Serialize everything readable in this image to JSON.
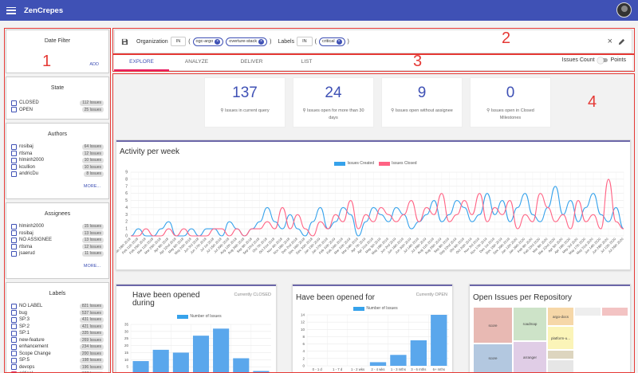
{
  "app": {
    "title": "ZenCrepes"
  },
  "annotations": [
    "1",
    "2",
    "3",
    "4"
  ],
  "sidebar": {
    "date_filter": {
      "title": "Date Filter",
      "add_label": "ADD"
    },
    "state": {
      "title": "State",
      "items": [
        {
          "label": "CLOSED",
          "count": "112 Issues"
        },
        {
          "label": "OPEN",
          "count": "25 Issues"
        }
      ]
    },
    "authors": {
      "title": "Authors",
      "more_label": "MORE...",
      "items": [
        {
          "label": "rosibaj",
          "count": "64 Issues"
        },
        {
          "label": "rtlsma",
          "count": "12 Issues"
        },
        {
          "label": "hlminh2000",
          "count": "10 Issues"
        },
        {
          "label": "kcullion",
          "count": "10 Issues"
        },
        {
          "label": "andricDu",
          "count": "8 Issues"
        }
      ]
    },
    "assignees": {
      "title": "Assignees",
      "more_label": "MORE...",
      "items": [
        {
          "label": "hlminh2000",
          "count": "15 Issues"
        },
        {
          "label": "rosibaj",
          "count": "13 Issues"
        },
        {
          "label": "NO ASSIGNEE",
          "count": "13 Issues"
        },
        {
          "label": "rtlsma",
          "count": "12 Issues"
        },
        {
          "label": "jsaerud",
          "count": "11 Issues"
        }
      ]
    },
    "labels": {
      "title": "Labels",
      "items": [
        {
          "label": "NO LABEL",
          "count": "821 Issues",
          "checked": false
        },
        {
          "label": "bug",
          "count": "537 Issues",
          "checked": false
        },
        {
          "label": "SP:3",
          "count": "431 Issues",
          "checked": false
        },
        {
          "label": "SP:2",
          "count": "421 Issues",
          "checked": false
        },
        {
          "label": "SP:1",
          "count": "335 Issues",
          "checked": false
        },
        {
          "label": "new-feature",
          "count": "269 Issues",
          "checked": false
        },
        {
          "label": "enhancement",
          "count": "234 Issues",
          "checked": false
        },
        {
          "label": "Scope Change",
          "count": "200 Issues",
          "checked": false
        },
        {
          "label": "SP:5",
          "count": "198 Issues",
          "checked": false
        },
        {
          "label": "devops",
          "count": "196 Issues",
          "checked": false
        },
        {
          "label": "critical",
          "count": "137 Issues",
          "checked": true
        }
      ]
    }
  },
  "query": {
    "organization_label": "Organization",
    "org_op": "IN",
    "org_chips": [
      "ogc-argo",
      "overture-stack"
    ],
    "labels_label": "Labels",
    "labels_op": "IN",
    "label_chips": [
      "critical"
    ]
  },
  "tabs": [
    "EXPLORE",
    "ANALYZE",
    "DELIVER",
    "LIST"
  ],
  "toggle": {
    "left": "Issues Count",
    "right": "Points"
  },
  "kpis": [
    {
      "value": "137",
      "desc": "Issues in current query"
    },
    {
      "value": "24",
      "desc": "Issues open for more than 30 days"
    },
    {
      "value": "9",
      "desc": "Issues open without assignee"
    },
    {
      "value": "0",
      "desc": "Issues open in Closed Milestones"
    }
  ],
  "activity": {
    "title": "Activity per week",
    "legend": [
      "Issues Created",
      "Issues Closed"
    ],
    "colors": [
      "#36a2eb",
      "#ff6384"
    ]
  },
  "opened_during": {
    "title_line1": "Have been opened",
    "title_line2": "during",
    "subtitle": "Currently CLOSED",
    "legend": "Number of Issues"
  },
  "opened_for": {
    "title": "Have been opened for",
    "subtitle": "Currently OPEN",
    "legend": "Number of Issues"
  },
  "repos": {
    "title": "Open Issues per Repository",
    "cells": [
      "score",
      "roadmap",
      "argo-docs",
      "platform-u...",
      "arranger",
      "score",
      "",
      ""
    ]
  },
  "chart_data": [
    {
      "type": "line",
      "title": "Activity per week",
      "x": [
        "Jan 28th 2018",
        "Feb 11th 2018",
        "Feb 25th 2018",
        "Mar 11th 2018",
        "Mar 25th 2018",
        "Apr 8th 2018",
        "Apr 22nd 2018",
        "May 6th 2018",
        "May 20th 2018",
        "Jun 3rd 2018",
        "Jun 17th 2018",
        "Jul 1st 2018",
        "Jul 15th 2018",
        "Jul 29th 2018",
        "Aug 12th 2018",
        "Aug 26th 2018",
        "Sep 9th 2018",
        "Sep 23rd 2018",
        "Oct 7th 2018",
        "Oct 21st 2018",
        "Nov 4th 2018",
        "Nov 18th 2018",
        "Dec 2nd 2018",
        "Dec 16th 2018",
        "Dec 30th 2018",
        "Jan 13th 2019",
        "Jan 27th 2019",
        "Feb 10th 2019",
        "Feb 24th 2019",
        "Mar 10th 2019",
        "Mar 24th 2019",
        "Apr 7th 2019",
        "Apr 21st 2019",
        "May 5th 2019",
        "May 19th 2019",
        "Jun 2nd 2019",
        "Jun 16th 2019",
        "Jun 30th 2019",
        "Jul 14th 2019",
        "Jul 28th 2019",
        "Aug 11th 2019",
        "Aug 25th 2019",
        "Sep 8th 2019",
        "Sep 22nd 2019",
        "Oct 6th 2019",
        "Oct 20th 2019",
        "Nov 3rd 2019",
        "Nov 17th 2019",
        "Dec 1st 2019",
        "Dec 15th 2019",
        "Dec 29th 2019",
        "Jan 12th 2020",
        "Jan 26th 2020",
        "Feb 9th 2020",
        "Feb 23rd 2020",
        "Mar 8th 2020",
        "Mar 22nd 2020",
        "Apr 5th 2020",
        "Apr 19th 2020",
        "May 3rd 2020",
        "May 17th 2020",
        "May 31st 2020",
        "Jun 14th 2020",
        "Jun 28th 2020",
        "Jul 12th 2020",
        "Jul 26th 2020"
      ],
      "ylim": [
        0,
        9
      ],
      "series": [
        {
          "name": "Issues Created",
          "values": [
            0,
            1,
            0,
            0,
            1,
            2,
            0,
            0,
            1,
            0,
            1,
            1,
            0,
            2,
            1,
            0,
            1,
            2,
            4,
            2,
            1,
            3,
            1,
            0,
            2,
            4,
            1,
            2,
            4,
            3,
            0,
            2,
            4,
            3,
            2,
            4,
            3,
            1,
            2,
            3,
            5,
            2,
            3,
            5,
            4,
            2,
            3,
            6,
            3,
            5,
            2,
            4,
            6,
            3,
            2,
            4,
            7,
            3,
            5,
            2,
            4,
            6,
            3,
            2,
            4,
            1
          ]
        },
        {
          "name": "Issues Closed",
          "values": [
            0,
            0,
            1,
            0,
            0,
            1,
            0,
            1,
            0,
            0,
            0,
            1,
            1,
            0,
            1,
            0,
            1,
            1,
            2,
            1,
            4,
            1,
            3,
            1,
            0,
            2,
            1,
            3,
            2,
            5,
            1,
            3,
            2,
            4,
            3,
            2,
            3,
            5,
            2,
            4,
            3,
            6,
            2,
            3,
            5,
            3,
            6,
            2,
            4,
            3,
            5,
            1,
            3,
            2,
            6,
            4,
            2,
            3,
            1,
            5,
            2,
            3,
            1,
            8,
            2,
            1
          ]
        }
      ]
    },
    {
      "type": "bar",
      "title": "Have been opened during",
      "series": [
        {
          "name": "Number of Issues",
          "values": [
            9,
            17,
            15,
            27,
            32,
            11,
            2
          ]
        }
      ],
      "categories": [
        "",
        "",
        "",
        "",
        "",
        "",
        ""
      ],
      "ylim": [
        0,
        35
      ]
    },
    {
      "type": "bar",
      "title": "Have been opened for",
      "categories": [
        "0 - 1 d",
        "1 - 7 d",
        "1 - 2 wks",
        "2 - 4 wks",
        "1 - 3 mths",
        "3 - 6 mths",
        "6+ mths"
      ],
      "series": [
        {
          "name": "Number of Issues",
          "values": [
            0,
            0,
            0,
            1,
            3,
            7,
            14
          ]
        }
      ],
      "ylim": [
        0,
        14
      ]
    }
  ]
}
